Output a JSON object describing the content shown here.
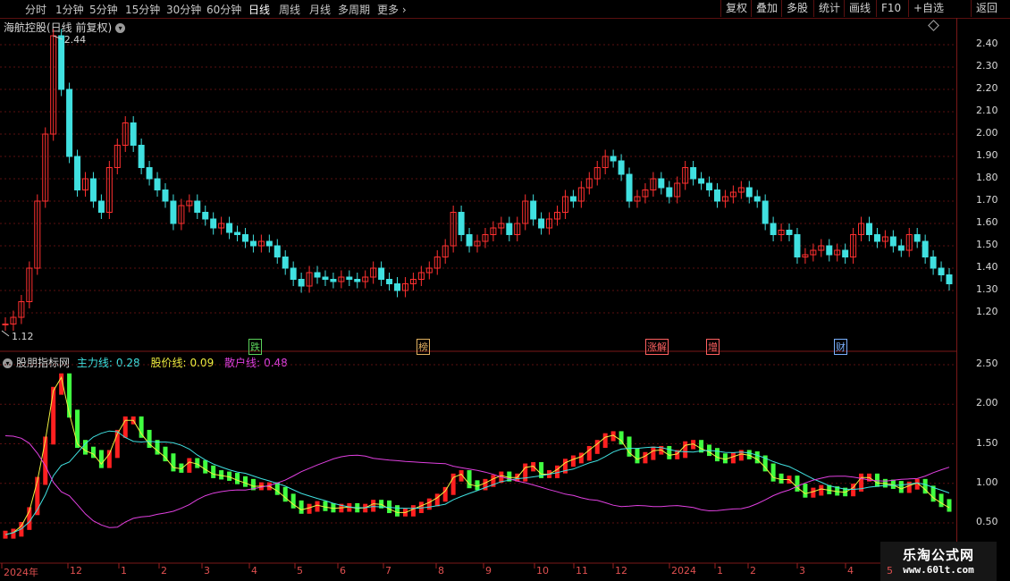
{
  "toolbar": {
    "timeframes": [
      "分时",
      "1分钟",
      "5分钟",
      "15分钟",
      "30分钟",
      "60分钟",
      "日线",
      "周线",
      "月线",
      "多周期",
      "更多"
    ],
    "active_timeframe": "日线",
    "buttons": [
      "复权",
      "叠加",
      "多股",
      "统计",
      "画线",
      "F10",
      "+自选",
      "返回"
    ]
  },
  "price_panel": {
    "title": "海航控股(日线 前复权)",
    "high_label": "2.44",
    "low_label": "1.12",
    "y_ticks": [
      "2.40",
      "2.30",
      "2.20",
      "2.10",
      "2.00",
      "1.90",
      "1.80",
      "1.70",
      "1.60",
      "1.50",
      "1.40",
      "1.30",
      "1.20"
    ],
    "events": [
      {
        "label": "跌",
        "color": "#5bd35b"
      },
      {
        "label": "榜",
        "color": "#e0b060"
      },
      {
        "label": "涨解",
        "color": "#ff6060"
      },
      {
        "label": "增",
        "color": "#ff6060"
      },
      {
        "label": "财",
        "color": "#7ab0ff"
      }
    ]
  },
  "indicator_panel": {
    "name": "股朋指标网",
    "lines": [
      {
        "label": "主力线:",
        "value": "0.28",
        "color": "#40e0e0"
      },
      {
        "label": "股价线:",
        "value": "0.09",
        "color": "#f0f040"
      },
      {
        "label": "散户线:",
        "value": "0.48",
        "color": "#e040e0"
      }
    ],
    "y_ticks": [
      "2.50",
      "2.00",
      "1.50",
      "1.00",
      "0.50"
    ]
  },
  "x_axis": {
    "labels": [
      "2024年",
      "12",
      "1",
      "2",
      "3",
      "4",
      "5",
      "6",
      "7",
      "8",
      "9",
      "10",
      "11",
      "12",
      "2024",
      "1",
      "2",
      "3",
      "4",
      "5"
    ]
  },
  "watermark": {
    "line1": "乐淘公式网",
    "line2": "www.60lt.com"
  },
  "colors": {
    "up": "#ff3030",
    "down": "#40e0e0",
    "ind_up": "#ff2020",
    "ind_down": "#40ff40",
    "grid": "#5a1010"
  },
  "chart_data": {
    "type": "candlestick",
    "ylim": [
      1.12,
      2.44
    ],
    "close_series": [
      1.15,
      1.18,
      1.25,
      1.4,
      1.7,
      2.0,
      2.44,
      2.2,
      1.9,
      1.75,
      1.8,
      1.7,
      1.65,
      1.85,
      1.95,
      2.05,
      1.95,
      1.85,
      1.8,
      1.75,
      1.7,
      1.6,
      1.68,
      1.7,
      1.65,
      1.62,
      1.58,
      1.6,
      1.56,
      1.55,
      1.52,
      1.5,
      1.52,
      1.5,
      1.45,
      1.4,
      1.35,
      1.32,
      1.38,
      1.36,
      1.35,
      1.34,
      1.36,
      1.35,
      1.34,
      1.36,
      1.4,
      1.35,
      1.33,
      1.3,
      1.33,
      1.35,
      1.38,
      1.4,
      1.45,
      1.5,
      1.65,
      1.55,
      1.5,
      1.52,
      1.55,
      1.58,
      1.6,
      1.55,
      1.6,
      1.7,
      1.62,
      1.58,
      1.62,
      1.65,
      1.72,
      1.7,
      1.76,
      1.8,
      1.85,
      1.9,
      1.88,
      1.82,
      1.7,
      1.72,
      1.75,
      1.8,
      1.76,
      1.72,
      1.78,
      1.85,
      1.8,
      1.78,
      1.75,
      1.7,
      1.72,
      1.74,
      1.76,
      1.72,
      1.7,
      1.6,
      1.55,
      1.57,
      1.55,
      1.45,
      1.46,
      1.48,
      1.5,
      1.46,
      1.48,
      1.45,
      1.55,
      1.6,
      1.55,
      1.52,
      1.54,
      1.5,
      1.48,
      1.55,
      1.52,
      1.45,
      1.4,
      1.37,
      1.33
    ]
  }
}
